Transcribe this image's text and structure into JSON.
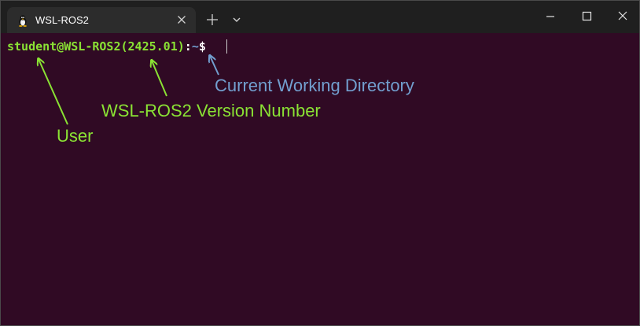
{
  "window": {
    "tab_title": "WSL-ROS2",
    "tab_icon": "linux-penguin-icon",
    "new_tab_icon": "plus-icon",
    "dropdown_icon": "chevron-down-icon",
    "controls": [
      "minimize-icon",
      "maximize-icon",
      "close-icon"
    ]
  },
  "terminal": {
    "prompt_user_host": "student@WSL-ROS2(2425.01)",
    "prompt_colon": ":",
    "prompt_cwd": "~",
    "prompt_dollar": "$"
  },
  "annotations": {
    "cwd": "Current Working Directory",
    "version": "WSL-ROS2 Version Number",
    "user": "User"
  },
  "colors": {
    "terminal_background": "#300a24",
    "titlebar": "#1f1f1f",
    "tab": "#2c2c2c",
    "green": "#8ae234",
    "blue": "#729fcf"
  }
}
